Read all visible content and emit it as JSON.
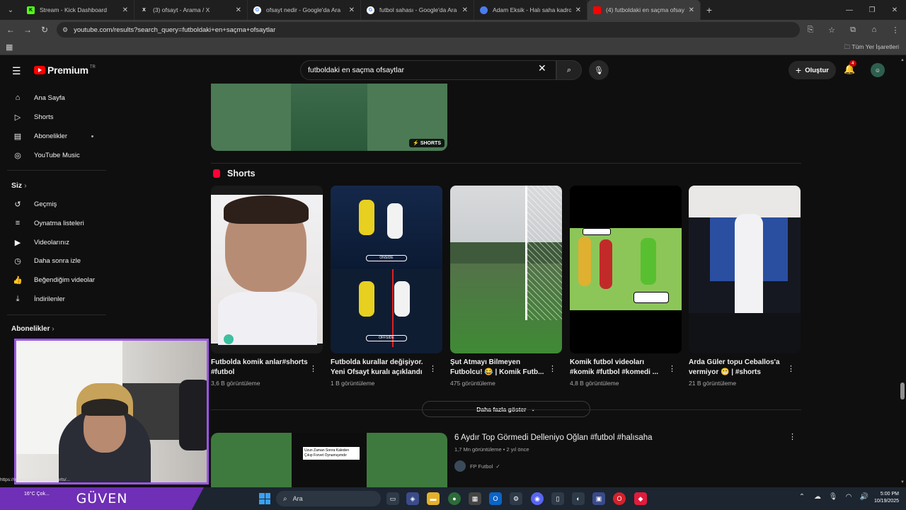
{
  "browser": {
    "tabs": [
      {
        "title": "Stream - Kick Dashboard",
        "icon": "kick-icon",
        "color": "#53fc18"
      },
      {
        "title": "(3) ofsayt - Arama / X",
        "icon": "x-icon",
        "color": "#ffffff"
      },
      {
        "title": "ofsayt nedir - Google'da Ara",
        "icon": "google-icon",
        "color": "#ffffff"
      },
      {
        "title": "futbol sahası - Google'da Ara",
        "icon": "google-icon",
        "color": "#ffffff"
      },
      {
        "title": "Adam Eksik - Halı saha kadro k",
        "icon": "site-icon",
        "color": "#4a7cf0"
      },
      {
        "title": "(4) futboldaki en saçma ofsaytl",
        "icon": "youtube-icon",
        "color": "#ff0000"
      }
    ],
    "url": "youtube.com/results?search_query=futboldaki+en+saçma+ofsaytlar",
    "all_bookmarks": "Tüm Yer İşaretleri"
  },
  "youtube": {
    "logo_text": "Premium",
    "logo_cc": "TR",
    "search_value": "futboldaki en saçma ofsaytlar",
    "create_label": "Oluştur",
    "notification_count": "4"
  },
  "sidebar": {
    "main": [
      {
        "label": "Ana Sayfa",
        "icon": "home-icon"
      },
      {
        "label": "Shorts",
        "icon": "shorts-icon"
      },
      {
        "label": "Abonelikler",
        "icon": "subscriptions-icon"
      },
      {
        "label": "YouTube Music",
        "icon": "music-icon"
      }
    ],
    "you_header": "Siz",
    "you": [
      {
        "label": "Geçmiş",
        "icon": "history-icon"
      },
      {
        "label": "Oynatma listeleri",
        "icon": "playlist-icon"
      },
      {
        "label": "Videolarınız",
        "icon": "video-icon"
      },
      {
        "label": "Daha sonra izle",
        "icon": "clock-icon"
      },
      {
        "label": "Beğendiğim videolar",
        "icon": "like-icon"
      },
      {
        "label": "İndirilenler",
        "icon": "download-icon"
      }
    ],
    "subs_header": "Abonelikler"
  },
  "results": {
    "top_short_tag": "SHORTS",
    "shelf_title": "Shorts",
    "shorts": [
      {
        "title": "Futbolda komik anlar#shorts #futbol",
        "views": "3,6 B görüntüleme"
      },
      {
        "title": "Futbolda kurallar değişiyor. Yeni Ofsayt kuralı açıklandı",
        "views": "1 B görüntüleme",
        "badges": [
          "ONSIDE",
          "OFFSIDE"
        ]
      },
      {
        "title": "Şut Atmayı Bilmeyen Futbolcu! 😂 | Komik Futb...",
        "views": "475 görüntüleme"
      },
      {
        "title": "Komik futbol videoları #komik #futbol #komedi ...",
        "views": "4,8 B görüntüleme"
      },
      {
        "title": "Arda Güler topu Ceballos'a vermiyor 😬 | #shorts",
        "views": "21 B görüntüleme"
      }
    ],
    "show_more": "Daha fazla göster",
    "video": {
      "title": "6 Aydır Top Görmedi Delleniyo Oğlan #futbol #halısaha",
      "meta": "1,7 Mn görüntüleme • 2 yıl önce",
      "channel": "FP Futbol",
      "thumb_caption": "Uzun Zaman Sonra Kaleden Çıkıp Forvet Oynamışımdır"
    }
  },
  "overlay": {
    "streamer_name": "GÜVEN",
    "status_url": "https://www.youtube.com/shorts/...",
    "weather": "16°C Çok..."
  },
  "taskbar": {
    "search_placeholder": "Ara",
    "time": "5:00 PM",
    "date": "10/19/2025"
  }
}
